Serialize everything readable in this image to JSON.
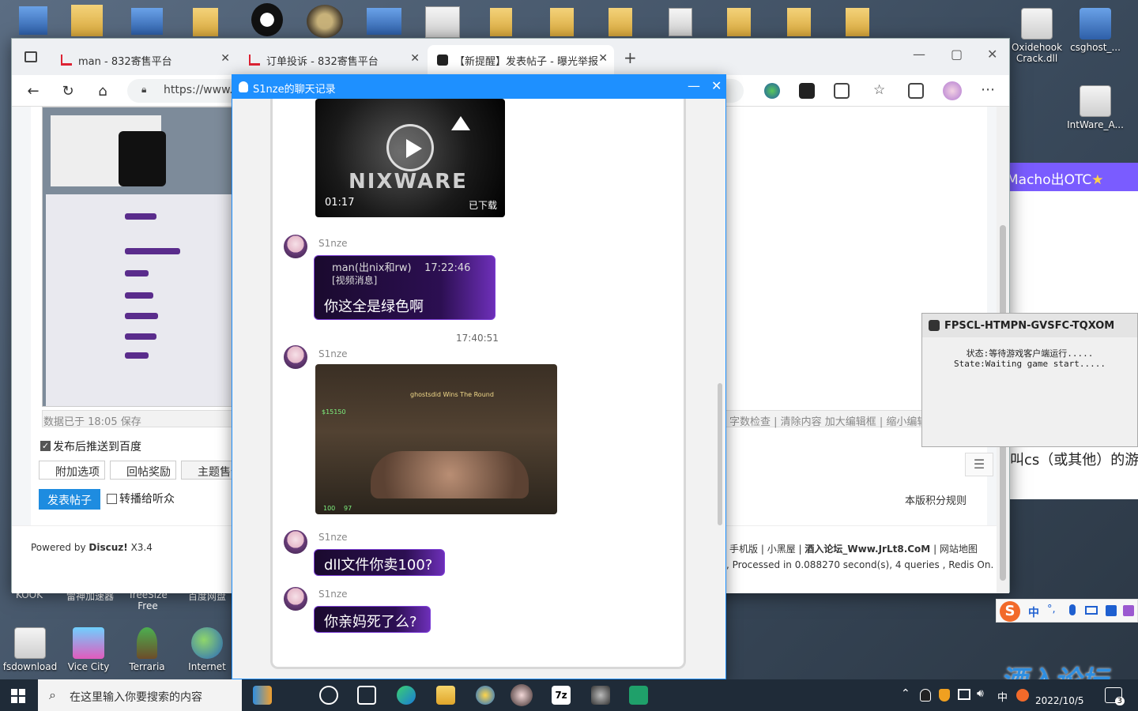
{
  "desktop": {
    "right_icons": [
      {
        "label": "Oxidehook Crack.dll"
      },
      {
        "label": "csghost_..."
      },
      {
        "label": "IntWare_A..."
      }
    ],
    "left_labels": [
      "KOOK",
      "雷神加速器",
      "TreeSize Free",
      "百度网盘"
    ],
    "bottom_icons": [
      {
        "label": "fsdownload"
      },
      {
        "label": "Vice City"
      },
      {
        "label": "Terraria"
      },
      {
        "label": "Internet"
      }
    ]
  },
  "browser": {
    "tabs": [
      {
        "title": "man - 832寄售平台"
      },
      {
        "title": "订单投诉 - 832寄售平台"
      },
      {
        "title": "【新提醒】发表帖子 - 曝光举报"
      }
    ],
    "url": "https://www.jr",
    "page": {
      "save_status": "数据已于 18:05 保存",
      "push_baidu_label": "发布后推送到百度",
      "options": [
        "附加选项",
        "回帖奖励",
        "主题售价"
      ],
      "submit_label": "发表帖子",
      "broadcast_label": "转播给听众",
      "editor_tools": "字数检查 | 清除内容    加大编辑框 | 缩小编辑框",
      "score_rules": "本版积分规则",
      "powered_by": "Powered by",
      "discuz": "Discuz!",
      "version": "X3.4",
      "footer_links": [
        "手机版",
        "小黑屋",
        "酒入论坛_Www.JrLt8.CoM",
        "网站地图"
      ],
      "processed": ", Processed in 0.088270 second(s), 4 queries , Redis On.",
      "side_text": "叫cs（或其他）的游",
      "side_banner": "Macho出OTC"
    }
  },
  "chat": {
    "title": "S1nze的聊天记录",
    "video": {
      "brand": "NIXWARE",
      "duration": "01:17",
      "status": "已下载"
    },
    "messages": [
      {
        "sender": "S1nze",
        "quote_header": "man(出nix和rw)    17:22:46",
        "quote_text": "[视频消息]",
        "text": "你这全是绿色啊"
      },
      {
        "sender": "S1nze",
        "text": "dll文件你卖100?"
      },
      {
        "sender": "S1nze",
        "text": "你亲妈死了么?"
      }
    ],
    "timestamp": "17:40:51",
    "image_sender": "S1nze",
    "game_screenshot": {
      "banner": "ghostsdid Wins The Round",
      "hud_money": "$15150",
      "hud_health": "100",
      "hud_armor": "97"
    }
  },
  "fpscl": {
    "title": "FPSCL-HTMPN-GVSFC-TQXOM",
    "status_cn": "状态:等待游戏客户端运行.....",
    "status_en": "State:Waiting game start....."
  },
  "ime": {
    "lang": "中",
    "punct": "°,"
  },
  "taskbar": {
    "search_placeholder": "在这里输入你要搜索的内容",
    "date": "2022/10/5",
    "notif_count": "3",
    "watermark": "酒入论坛"
  },
  "colors": {
    "accent": "#1e90ff",
    "bubble_purple": "#2c0f52",
    "submit_blue": "#1e8ce0"
  }
}
